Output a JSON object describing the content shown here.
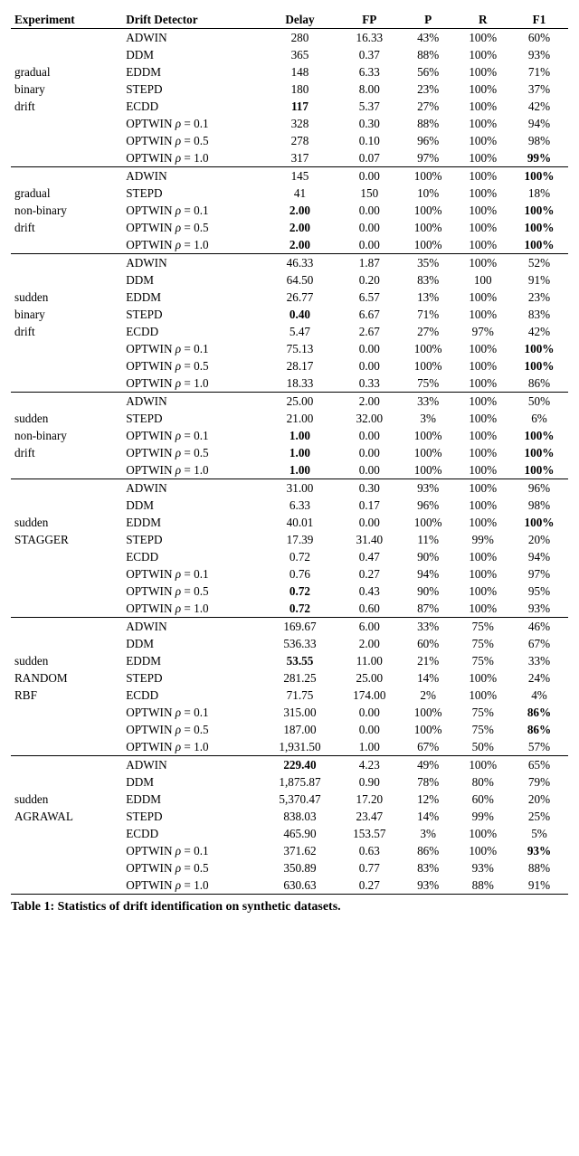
{
  "caption": "Table 1: Statistics of drift identification on synthetic datasets.",
  "headers": [
    "Experiment",
    "Drift Detector",
    "Delay",
    "FP",
    "P",
    "R",
    "F1"
  ],
  "groups": [
    {
      "label_lines": [
        "",
        "",
        "gradual",
        "binary",
        "drift",
        "",
        "",
        ""
      ],
      "rows": [
        {
          "det": "ADWIN",
          "delay": "280",
          "db": false,
          "fp": "16.33",
          "p": "43%",
          "r": "100%",
          "f1": "60%",
          "f1b": false
        },
        {
          "det": "DDM",
          "delay": "365",
          "db": false,
          "fp": "0.37",
          "p": "88%",
          "r": "100%",
          "f1": "93%",
          "f1b": false
        },
        {
          "det": "EDDM",
          "delay": "148",
          "db": false,
          "fp": "6.33",
          "p": "56%",
          "r": "100%",
          "f1": "71%",
          "f1b": false
        },
        {
          "det": "STEPD",
          "delay": "180",
          "db": false,
          "fp": "8.00",
          "p": "23%",
          "r": "100%",
          "f1": "37%",
          "f1b": false
        },
        {
          "det": "ECDD",
          "delay": "117",
          "db": true,
          "fp": "5.37",
          "p": "27%",
          "r": "100%",
          "f1": "42%",
          "f1b": false
        },
        {
          "det": "OPTWIN ρ = 0.1",
          "delay": "328",
          "db": false,
          "fp": "0.30",
          "p": "88%",
          "r": "100%",
          "f1": "94%",
          "f1b": false
        },
        {
          "det": "OPTWIN ρ = 0.5",
          "delay": "278",
          "db": false,
          "fp": "0.10",
          "p": "96%",
          "r": "100%",
          "f1": "98%",
          "f1b": false
        },
        {
          "det": "OPTWIN ρ = 1.0",
          "delay": "317",
          "db": false,
          "fp": "0.07",
          "p": "97%",
          "r": "100%",
          "f1": "99%",
          "f1b": true
        }
      ]
    },
    {
      "label_lines": [
        "",
        "gradual",
        "non-binary",
        "drift",
        ""
      ],
      "rows": [
        {
          "det": "ADWIN",
          "delay": "145",
          "db": false,
          "fp": "0.00",
          "p": "100%",
          "r": "100%",
          "f1": "100%",
          "f1b": true
        },
        {
          "det": "STEPD",
          "delay": "41",
          "db": false,
          "fp": "150",
          "p": "10%",
          "r": "100%",
          "f1": "18%",
          "f1b": false
        },
        {
          "det": "OPTWIN ρ = 0.1",
          "delay": "2.00",
          "db": true,
          "fp": "0.00",
          "p": "100%",
          "r": "100%",
          "f1": "100%",
          "f1b": true
        },
        {
          "det": "OPTWIN ρ = 0.5",
          "delay": "2.00",
          "db": true,
          "fp": "0.00",
          "p": "100%",
          "r": "100%",
          "f1": "100%",
          "f1b": true
        },
        {
          "det": "OPTWIN ρ = 1.0",
          "delay": "2.00",
          "db": true,
          "fp": "0.00",
          "p": "100%",
          "r": "100%",
          "f1": "100%",
          "f1b": true
        }
      ]
    },
    {
      "label_lines": [
        "",
        "",
        "sudden",
        "binary",
        "drift",
        "",
        "",
        ""
      ],
      "rows": [
        {
          "det": "ADWIN",
          "delay": "46.33",
          "db": false,
          "fp": "1.87",
          "p": "35%",
          "r": "100%",
          "f1": "52%",
          "f1b": false
        },
        {
          "det": "DDM",
          "delay": "64.50",
          "db": false,
          "fp": "0.20",
          "p": "83%",
          "r": "100",
          "f1": "91%",
          "f1b": false
        },
        {
          "det": "EDDM",
          "delay": "26.77",
          "db": false,
          "fp": "6.57",
          "p": "13%",
          "r": "100%",
          "f1": "23%",
          "f1b": false
        },
        {
          "det": "STEPD",
          "delay": "0.40",
          "db": true,
          "fp": "6.67",
          "p": "71%",
          "r": "100%",
          "f1": "83%",
          "f1b": false
        },
        {
          "det": "ECDD",
          "delay": "5.47",
          "db": false,
          "fp": "2.67",
          "p": "27%",
          "r": "97%",
          "f1": "42%",
          "f1b": false
        },
        {
          "det": "OPTWIN ρ = 0.1",
          "delay": "75.13",
          "db": false,
          "fp": "0.00",
          "p": "100%",
          "r": "100%",
          "f1": "100%",
          "f1b": true
        },
        {
          "det": "OPTWIN ρ = 0.5",
          "delay": "28.17",
          "db": false,
          "fp": "0.00",
          "p": "100%",
          "r": "100%",
          "f1": "100%",
          "f1b": true
        },
        {
          "det": "OPTWIN ρ = 1.0",
          "delay": "18.33",
          "db": false,
          "fp": "0.33",
          "p": "75%",
          "r": "100%",
          "f1": "86%",
          "f1b": false
        }
      ]
    },
    {
      "label_lines": [
        "",
        "sudden",
        "non-binary",
        "drift",
        ""
      ],
      "rows": [
        {
          "det": "ADWIN",
          "delay": "25.00",
          "db": false,
          "fp": "2.00",
          "p": "33%",
          "r": "100%",
          "f1": "50%",
          "f1b": false
        },
        {
          "det": "STEPD",
          "delay": "21.00",
          "db": false,
          "fp": "32.00",
          "p": "3%",
          "r": "100%",
          "f1": "6%",
          "f1b": false
        },
        {
          "det": "OPTWIN ρ = 0.1",
          "delay": "1.00",
          "db": true,
          "fp": "0.00",
          "p": "100%",
          "r": "100%",
          "f1": "100%",
          "f1b": true
        },
        {
          "det": "OPTWIN ρ = 0.5",
          "delay": "1.00",
          "db": true,
          "fp": "0.00",
          "p": "100%",
          "r": "100%",
          "f1": "100%",
          "f1b": true
        },
        {
          "det": "OPTWIN ρ = 1.0",
          "delay": "1.00",
          "db": true,
          "fp": "0.00",
          "p": "100%",
          "r": "100%",
          "f1": "100%",
          "f1b": true
        }
      ]
    },
    {
      "label_lines": [
        "",
        "",
        "sudden",
        "STAGGER",
        "",
        "",
        "",
        ""
      ],
      "rows": [
        {
          "det": "ADWIN",
          "delay": "31.00",
          "db": false,
          "fp": "0.30",
          "p": "93%",
          "r": "100%",
          "f1": "96%",
          "f1b": false
        },
        {
          "det": "DDM",
          "delay": "6.33",
          "db": false,
          "fp": "0.17",
          "p": "96%",
          "r": "100%",
          "f1": "98%",
          "f1b": false
        },
        {
          "det": "EDDM",
          "delay": "40.01",
          "db": false,
          "fp": "0.00",
          "p": "100%",
          "r": "100%",
          "f1": "100%",
          "f1b": true
        },
        {
          "det": "STEPD",
          "delay": "17.39",
          "db": false,
          "fp": "31.40",
          "p": "11%",
          "r": "99%",
          "f1": "20%",
          "f1b": false
        },
        {
          "det": "ECDD",
          "delay": "0.72",
          "db": false,
          "fp": "0.47",
          "p": "90%",
          "r": "100%",
          "f1": "94%",
          "f1b": false
        },
        {
          "det": "OPTWIN ρ = 0.1",
          "delay": "0.76",
          "db": false,
          "fp": "0.27",
          "p": "94%",
          "r": "100%",
          "f1": "97%",
          "f1b": false
        },
        {
          "det": "OPTWIN ρ = 0.5",
          "delay": "0.72",
          "db": true,
          "fp": "0.43",
          "p": "90%",
          "r": "100%",
          "f1": "95%",
          "f1b": false
        },
        {
          "det": "OPTWIN ρ = 1.0",
          "delay": "0.72",
          "db": true,
          "fp": "0.60",
          "p": "87%",
          "r": "100%",
          "f1": "93%",
          "f1b": false
        }
      ]
    },
    {
      "label_lines": [
        "",
        "",
        "sudden",
        "RANDOM",
        "RBF",
        "",
        "",
        ""
      ],
      "rows": [
        {
          "det": "ADWIN",
          "delay": "169.67",
          "db": false,
          "fp": "6.00",
          "p": "33%",
          "r": "75%",
          "f1": "46%",
          "f1b": false
        },
        {
          "det": "DDM",
          "delay": "536.33",
          "db": false,
          "fp": "2.00",
          "p": "60%",
          "r": "75%",
          "f1": "67%",
          "f1b": false
        },
        {
          "det": "EDDM",
          "delay": "53.55",
          "db": true,
          "fp": "11.00",
          "p": "21%",
          "r": "75%",
          "f1": "33%",
          "f1b": false
        },
        {
          "det": "STEPD",
          "delay": "281.25",
          "db": false,
          "fp": "25.00",
          "p": "14%",
          "r": "100%",
          "f1": "24%",
          "f1b": false
        },
        {
          "det": "ECDD",
          "delay": "71.75",
          "db": false,
          "fp": "174.00",
          "p": "2%",
          "r": "100%",
          "f1": "4%",
          "f1b": false
        },
        {
          "det": "OPTWIN ρ = 0.1",
          "delay": "315.00",
          "db": false,
          "fp": "0.00",
          "p": "100%",
          "r": "75%",
          "f1": "86%",
          "f1b": true
        },
        {
          "det": "OPTWIN ρ = 0.5",
          "delay": "187.00",
          "db": false,
          "fp": "0.00",
          "p": "100%",
          "r": "75%",
          "f1": "86%",
          "f1b": true
        },
        {
          "det": "OPTWIN ρ = 1.0",
          "delay": "1,931.50",
          "db": false,
          "fp": "1.00",
          "p": "67%",
          "r": "50%",
          "f1": "57%",
          "f1b": false
        }
      ]
    },
    {
      "label_lines": [
        "",
        "",
        "sudden",
        "AGRAWAL",
        "",
        "",
        "",
        ""
      ],
      "rows": [
        {
          "det": "ADWIN",
          "delay": "229.40",
          "db": true,
          "fp": "4.23",
          "p": "49%",
          "r": "100%",
          "f1": "65%",
          "f1b": false
        },
        {
          "det": "DDM",
          "delay": "1,875.87",
          "db": false,
          "fp": "0.90",
          "p": "78%",
          "r": "80%",
          "f1": "79%",
          "f1b": false
        },
        {
          "det": "EDDM",
          "delay": "5,370.47",
          "db": false,
          "fp": "17.20",
          "p": "12%",
          "r": "60%",
          "f1": "20%",
          "f1b": false
        },
        {
          "det": "STEPD",
          "delay": "838.03",
          "db": false,
          "fp": "23.47",
          "p": "14%",
          "r": "99%",
          "f1": "25%",
          "f1b": false
        },
        {
          "det": "ECDD",
          "delay": "465.90",
          "db": false,
          "fp": "153.57",
          "p": "3%",
          "r": "100%",
          "f1": "5%",
          "f1b": false
        },
        {
          "det": "OPTWIN ρ = 0.1",
          "delay": "371.62",
          "db": false,
          "fp": "0.63",
          "p": "86%",
          "r": "100%",
          "f1": "93%",
          "f1b": true
        },
        {
          "det": "OPTWIN ρ = 0.5",
          "delay": "350.89",
          "db": false,
          "fp": "0.77",
          "p": "83%",
          "r": "93%",
          "f1": "88%",
          "f1b": false
        },
        {
          "det": "OPTWIN ρ = 1.0",
          "delay": "630.63",
          "db": false,
          "fp": "0.27",
          "p": "93%",
          "r": "88%",
          "f1": "91%",
          "f1b": false
        }
      ]
    }
  ]
}
